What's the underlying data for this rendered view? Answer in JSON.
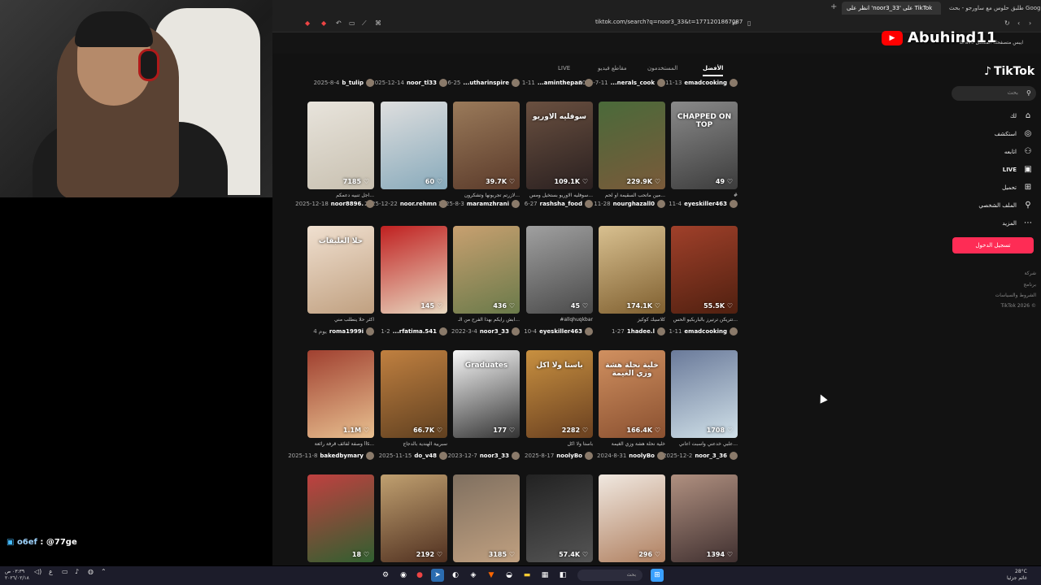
{
  "browser": {
    "tabs": [
      {
        "label": "طلبق حلوس مع ساورجو - بحث Google"
      },
      {
        "label": "انظر على 'noor3_33' على TikTok"
      }
    ],
    "url": "tiktok.com/search?q=noor3_33&t=1771201867087",
    "bookmark_text": "Brave ايبس متصفحك المفضل"
  },
  "overlay": {
    "channel": "Abuhind11",
    "chat_user": "o6ef",
    "chat_message": ": @77ge"
  },
  "tiktok": {
    "logo": "TikTok",
    "search_placeholder": "بحث",
    "nav": [
      {
        "icon": "home-icon",
        "label": "لك",
        "glyph": "⌂"
      },
      {
        "icon": "compass-icon",
        "label": "استكشف",
        "glyph": "◎"
      },
      {
        "icon": "following-icon",
        "label": "اتابعه",
        "glyph": "⚇"
      },
      {
        "icon": "live-icon",
        "label": "LIVE",
        "glyph": "▣"
      },
      {
        "icon": "upload-icon",
        "label": "تحميل",
        "glyph": "⊞"
      },
      {
        "icon": "profile-icon",
        "label": "الملف الشخصي",
        "glyph": "⚲"
      },
      {
        "icon": "more-icon",
        "label": "المزيد",
        "glyph": "⋯"
      }
    ],
    "login_label": "تسجيل الدخول",
    "footer": [
      "شركة",
      "برنامج",
      "الشروط والسياسات",
      "TikTok 2026 ©"
    ],
    "tabs": [
      "الأفضل",
      "المستخدمون",
      "مقاطع فيديو",
      "LIVE"
    ],
    "top_meta": [
      {
        "user": "emadcooking",
        "date": "11-13"
      },
      {
        "user": "...nerals_cook",
        "date": "2025-7-11"
      },
      {
        "user": "...aminthepan",
        "date": "1-11"
      },
      {
        "user": "...utharinspire",
        "date": "6-25"
      },
      {
        "user": "noor_tl33",
        "date": "2025-12-14"
      },
      {
        "user": "b_tulip",
        "date": "2025-8-4"
      }
    ],
    "rows": [
      {
        "items": [
          {
            "likes": "49",
            "caption": "#",
            "text": "CHAPPED ON TOP",
            "user": "eyeskiller463",
            "date": "11-4"
          },
          {
            "likes": "229.9K",
            "caption": "مين ماتحب السقيمة او لحم...",
            "text": "",
            "user": "nourghazall0",
            "date": "11-28"
          },
          {
            "likes": "109.1K",
            "caption": "سوفليه الاوريو بستخيل ومس...",
            "text": "سوفليه الاوريو",
            "user": "rashsha_food",
            "date": "6-27"
          },
          {
            "likes": "39.7K",
            "caption": "لازرتم تجربونها وتشكرون...",
            "text": "",
            "user": "maramzhrani",
            "date": "2025-8-3"
          },
          {
            "likes": "60",
            "caption": "",
            "text": "",
            "user": "noor.rehmn",
            "date": "2025-12-22"
          },
          {
            "likes": "7185",
            "caption": "اجل تنبيه دعمكم...",
            "text": "",
            "user": "noor8896.",
            "date": "2025-12-18"
          }
        ]
      },
      {
        "items": [
          {
            "likes": "55.5K",
            "caption": "تتريكن ترتيرز بالباربكيو الحس...",
            "text": "",
            "user": "emadcooking",
            "date": "1-11"
          },
          {
            "likes": "174.1K",
            "caption": "كلاسيك كوكيز",
            "text": "",
            "user": "1hadee.l",
            "date": "1-27"
          },
          {
            "likes": "45",
            "caption": "#allqhuqkbar",
            "text": "",
            "user": "eyeskiller463",
            "date": "10-4"
          },
          {
            "likes": "436",
            "caption": "ابش رايكم بهذا الفرح من الـ...",
            "text": "",
            "user": "noor3_33",
            "date": "2022-3-4"
          },
          {
            "likes": "145",
            "caption": "",
            "text": "",
            "user": "...rfatima.541",
            "date": "1-2"
          },
          {
            "likes": "",
            "caption": "اكثر حلا ينطلب مني",
            "text": "حلا العلبقات",
            "user": "roma1999i",
            "date": "4 يوم"
          }
        ]
      },
      {
        "items": [
          {
            "likes": "1708",
            "caption": "علبي خدعني واسبت اعاني...",
            "text": "",
            "user": "noor_3_36",
            "date": "2025-12-2"
          },
          {
            "likes": "166.4K",
            "caption": "خلية نحلة هشة وزي الغيمة",
            "text": "خلية نحلة هشة وزي الغيمة",
            "user": "noolyBo",
            "date": "2024-8-31"
          },
          {
            "likes": "2282",
            "caption": "باستا ولا اكل",
            "text": "باستا ولا اكل",
            "user": "noolyBo",
            "date": "2025-8-17"
          },
          {
            "likes": "177",
            "caption": "",
            "text": "Graduates",
            "user": "noor3_33",
            "date": "2023-12-7"
          },
          {
            "likes": "66.7K",
            "caption": "سبريية الهندية بالدجاج",
            "text": "",
            "user": "do_v48",
            "date": "2025-11-15"
          },
          {
            "likes": "1.1M",
            "caption": "وصفة لفائف قرفة رائعة lls...",
            "text": "",
            "user": "bakedbymary",
            "date": "2025-11-8"
          }
        ]
      },
      {
        "items": [
          {
            "likes": "1394",
            "caption": "",
            "text": "",
            "user": "",
            "date": ""
          },
          {
            "likes": "296",
            "caption": "",
            "text": "",
            "user": "",
            "date": ""
          },
          {
            "likes": "57.4K",
            "caption": "",
            "text": "",
            "user": "",
            "date": ""
          },
          {
            "likes": "3185",
            "caption": "",
            "text": "",
            "user": "",
            "date": ""
          },
          {
            "likes": "2192",
            "caption": "",
            "text": "",
            "user": "",
            "date": ""
          },
          {
            "likes": "18",
            "caption": "",
            "text": "",
            "user": "",
            "date": ""
          }
        ]
      }
    ]
  },
  "taskbar": {
    "search": "بحث",
    "weather_temp": "28°C",
    "weather_text": "غائم جزئيا",
    "time": "٠٣:٣٩ ص",
    "date": "٢٠٢٦/٠٢/١٨"
  },
  "colors": {
    "accent": "#fe2c55",
    "page_bg": "#121212",
    "youtube": "#ff0000"
  }
}
